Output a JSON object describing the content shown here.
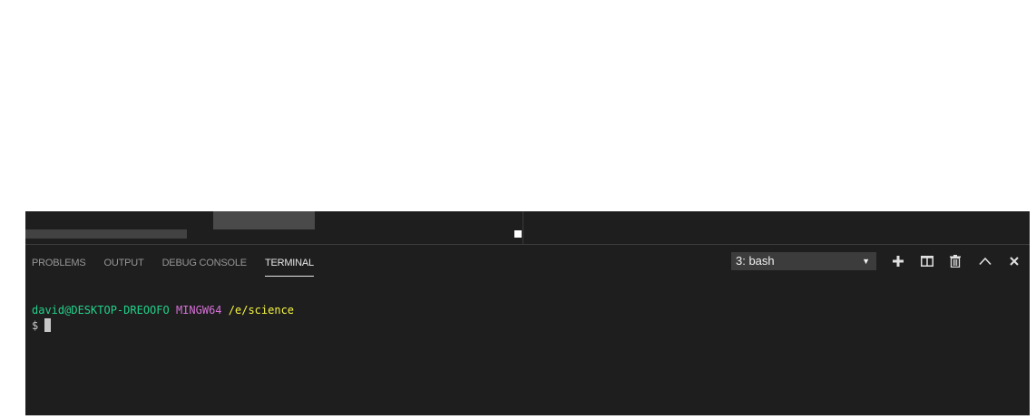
{
  "panel": {
    "tabs": [
      {
        "label": "PROBLEMS"
      },
      {
        "label": "OUTPUT"
      },
      {
        "label": "DEBUG CONSOLE"
      },
      {
        "label": "TERMINAL"
      }
    ],
    "active_tab": "TERMINAL",
    "terminal_selector": {
      "value": "3: bash"
    },
    "actions": [
      {
        "icon": "plus-icon",
        "label": "New Terminal"
      },
      {
        "icon": "split-icon",
        "label": "Split Terminal"
      },
      {
        "icon": "trash-icon",
        "label": "Kill Terminal"
      },
      {
        "icon": "chevron-up-icon",
        "label": "Maximize Panel"
      },
      {
        "icon": "close-icon",
        "label": "Close Panel"
      }
    ]
  },
  "terminal": {
    "user_host": "david@DESKTOP-DREOOFO",
    "system": "MINGW64",
    "path": "/e/science",
    "prompt": "$"
  },
  "colors": {
    "background": "#1e1e1e",
    "user_host": "#23d18b",
    "system": "#d670d6",
    "path": "#f5f543"
  }
}
